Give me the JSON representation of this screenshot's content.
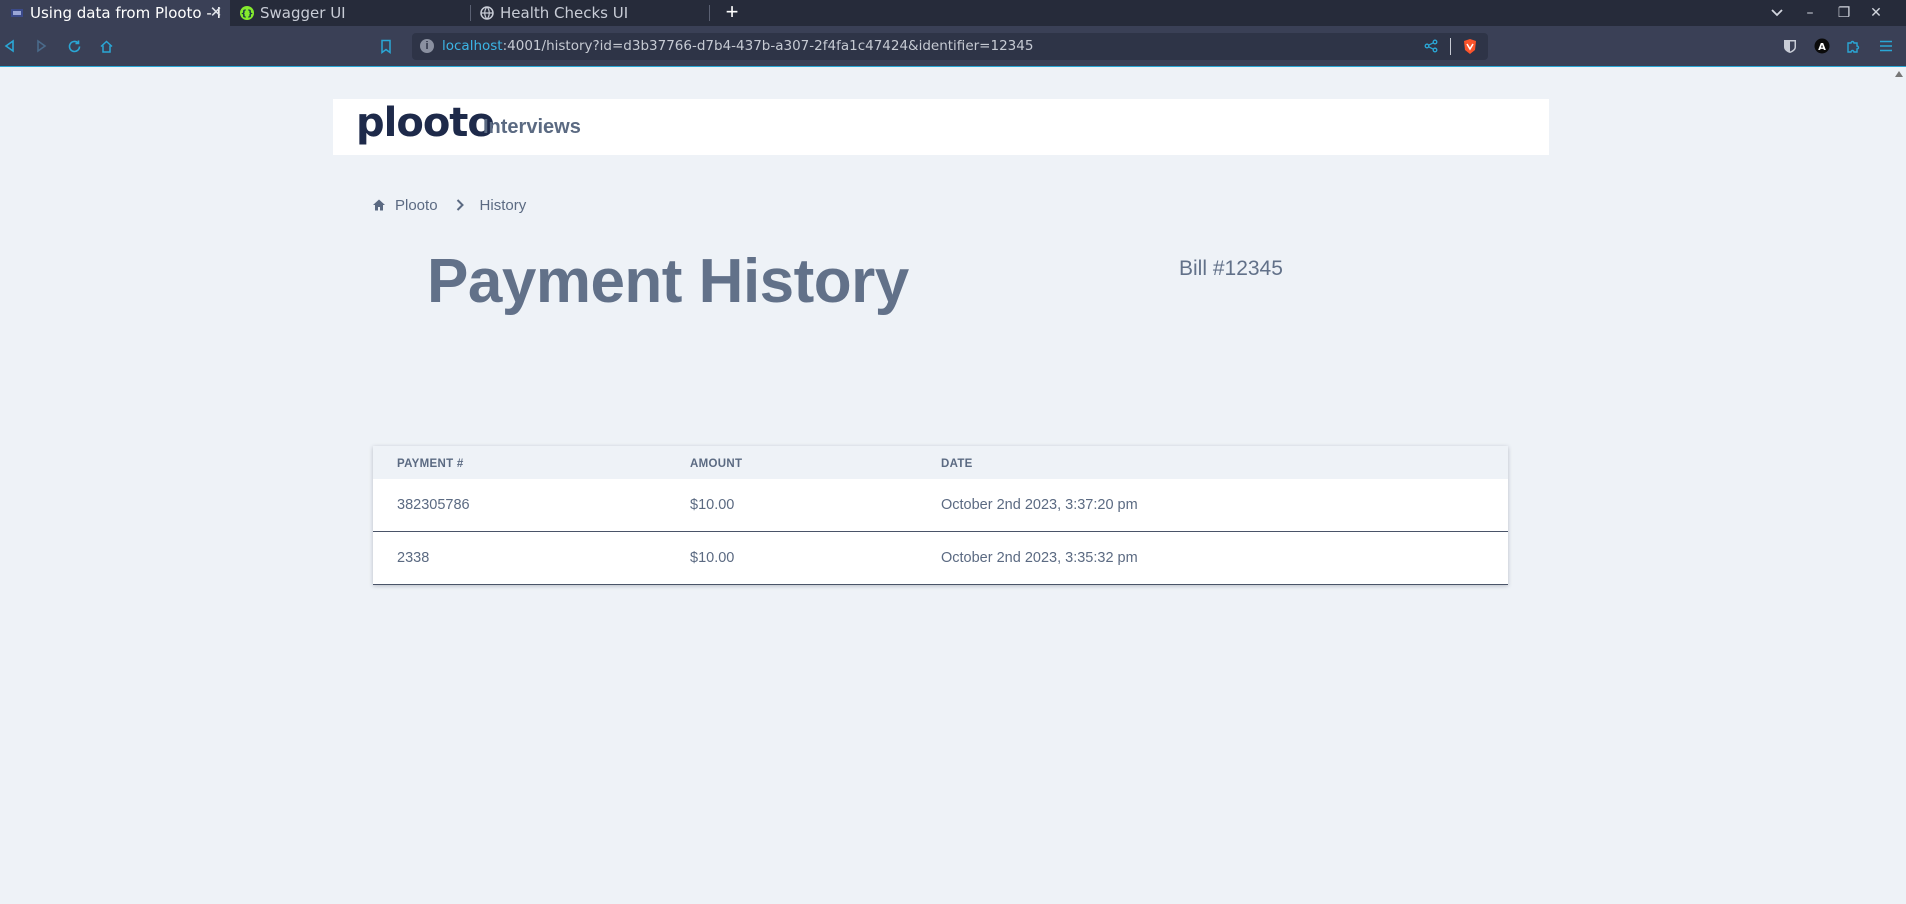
{
  "browser": {
    "tabs": [
      {
        "title": "Using data from Plooto - I",
        "active": true
      },
      {
        "title": "Swagger UI",
        "active": false
      },
      {
        "title": "Health Checks UI",
        "active": false
      }
    ],
    "url": {
      "host": "localhost",
      "rest": ":4001/history?id=d3b37766-d7b4-437b-a307-2f4fa1c47424&identifier=12345"
    },
    "colors": {
      "accent": "#2aa7d6",
      "swagger": "#85ea2d",
      "brave": "#fb542b"
    }
  },
  "app": {
    "logo": "plooto",
    "logo_sub": "Interviews"
  },
  "breadcrumb": {
    "items": [
      "Plooto",
      "History"
    ]
  },
  "page": {
    "title": "Payment History",
    "bill": "Bill #12345"
  },
  "table": {
    "headers": [
      "PAYMENT #",
      "AMOUNT",
      "DATE"
    ],
    "rows": [
      {
        "payment": "382305786",
        "amount": "$10.00",
        "date": "October 2nd 2023, 3:37:20 pm"
      },
      {
        "payment": "2338",
        "amount": "$10.00",
        "date": "October 2nd 2023, 3:35:32 pm"
      }
    ]
  }
}
